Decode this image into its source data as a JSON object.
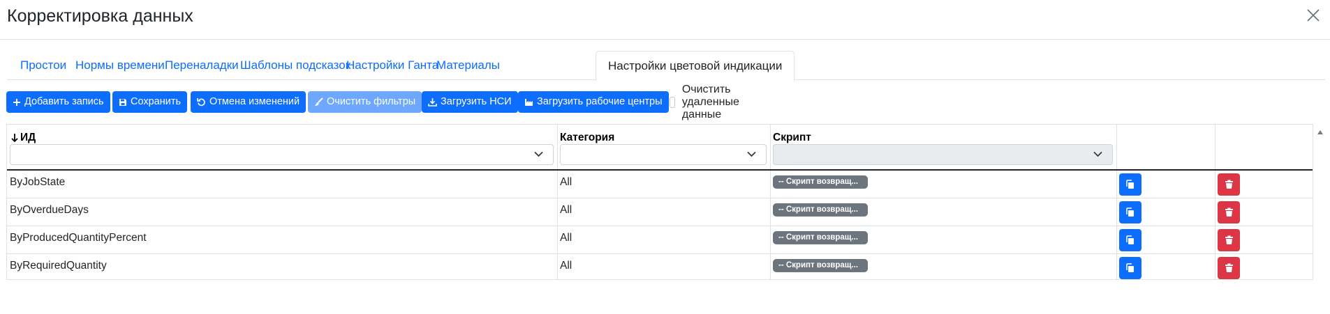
{
  "dialog": {
    "title": "Корректировка данных"
  },
  "tabs": [
    {
      "label": "Простои"
    },
    {
      "label": "Нормы времени"
    },
    {
      "label": "Переналадки"
    },
    {
      "label": "Шаблоны подсказок"
    },
    {
      "label": "Настройки Ганта"
    },
    {
      "label": "Материалы"
    },
    {
      "label": "Настройки цветовой индикации",
      "active": true
    }
  ],
  "toolbar": {
    "add": "Добавить запись",
    "save": "Сохранить",
    "cancel": "Отмена изменений",
    "clear_filters": "Очистить фильтры",
    "load_nsi": "Загрузить НСИ",
    "load_centers": "Загрузить рабочие центры",
    "clear_deleted": "Очистить удаленные данные"
  },
  "table": {
    "columns": [
      {
        "label": "ИД",
        "sort": "desc"
      },
      {
        "label": "Категория"
      },
      {
        "label": "Скрипт"
      }
    ],
    "rows": [
      {
        "id": "ByJobState",
        "category": "All",
        "script": "-- Скрипт возвращ..."
      },
      {
        "id": "ByOverdueDays",
        "category": "All",
        "script": "-- Скрипт возвращ..."
      },
      {
        "id": "ByProducedQuantityPercent",
        "category": "All",
        "script": "-- Скрипт возвращ..."
      },
      {
        "id": "ByRequiredQuantity",
        "category": "All",
        "script": "-- Скрипт возвращ..."
      }
    ]
  },
  "colors": {
    "primary": "#0d6efd",
    "primary_disabled": "#6ea8fe",
    "danger": "#dc3545",
    "badge": "#6c757d"
  },
  "icons": [
    "close-icon",
    "plus-icon",
    "save-icon",
    "undo-icon",
    "brush-icon",
    "download-icon",
    "factory-icon",
    "sort-down-icon",
    "chevron-down-icon",
    "copy-icon",
    "trash-icon"
  ]
}
